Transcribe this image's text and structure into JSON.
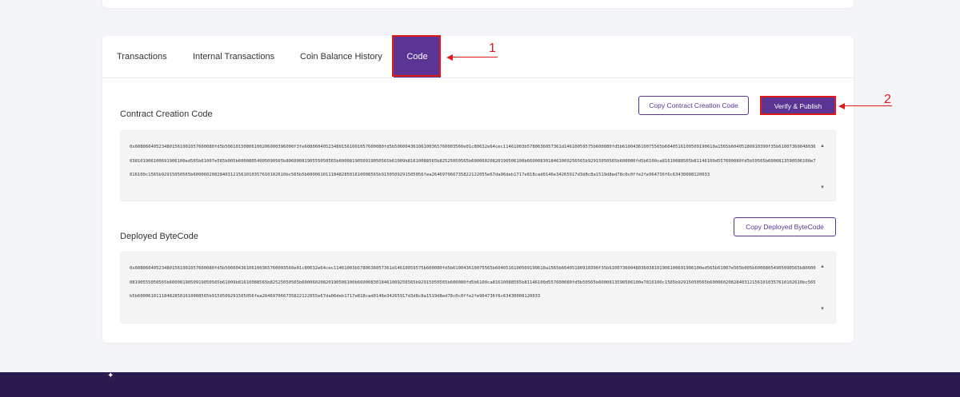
{
  "tabs": [
    {
      "label": "Transactions"
    },
    {
      "label": "Internal Transactions"
    },
    {
      "label": "Coin Balance History"
    },
    {
      "label": "Code"
    }
  ],
  "creation": {
    "title": "Contract Creation Code",
    "copy_label": "Copy Contract Creation Code",
    "verify_label": "Verify & Publish",
    "code": "0x608060405234801561001057600080fd5b50610150806100206000396000f3fe608060405234801561001057600080fd5b50600436106100365760003560e01c80632e64cec11461003b5780636057361d14610059575b600080fd5b610043610075565b6040516100509190610a1565b60405180910390f35b61007360048036038101906100691906100ed565b61007e565b005b60008054905090565b8060008190555050565b6000819050919050565b61009b81610088565b82525050565b60006020820190506100b6600083018461009256565b92915050565b600080fd5b6100ca81610088565b81146100d557600080fd5b50565b6000813590506100e7816100c1565b92915050565b60006020828403121561010357610102610bc565b5b600061011184828501610008565b9150509291505056fea264697066735822122055e67da06deb1717e818cad0146e34265917d3d8c8a1519d8ed78c0c0ffe2fe964736f6c63430008120033"
  },
  "deployed": {
    "title": "Deployed ByteCode",
    "copy_label": "Copy Deployed ByteCode",
    "code": "0x608060405234801561001057600080fd5b50600436106100365760003560e01c80632e64cec11461003b5780636057361d14610059575b600080fd5b610043610075565b6040516100509190610a1565b60405180910390f35b61007360048036038101906100691906100ed565b61007e565b005b60008054905090565b8060008190555050565b6000819050919050565b61009b81610088565b82525050565b60006020820190506100b6600083018461009256565b92915050565b600080fd5b6100ca81610088565b81146100d557600080fd5b50565b6000813590506100e7816100c1565b92915050565b60006020828403121561010357610102610bc565b5b600061011184828501610008565b9150509291505056fea264697066735822122055e67da06deb1717e818cad0146e34265917d3d8c8a1519d8ed78c0c0ffe2fe964736f6c63430008120033"
  },
  "annotations": {
    "one": "1",
    "two": "2"
  },
  "colors": {
    "accent": "#5a3594",
    "annotation": "#e01a1a",
    "footer": "#2a1a4e"
  },
  "scroll": {
    "up_icon": "triangle-up-icon",
    "down_icon": "triangle-down-icon"
  }
}
